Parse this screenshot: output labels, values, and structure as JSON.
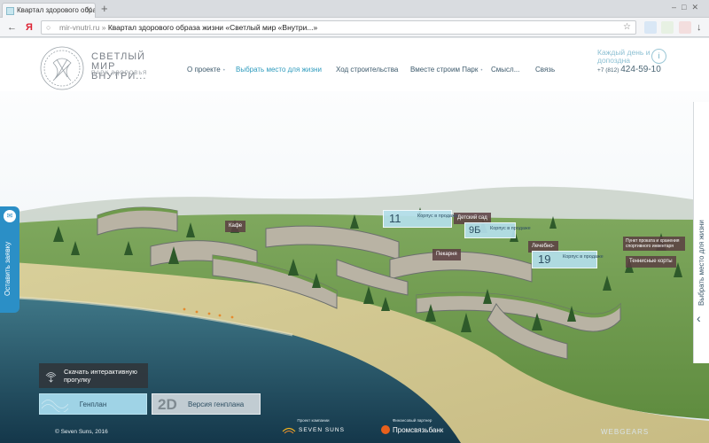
{
  "browser": {
    "tab_title": "Квартал здорового образа",
    "address_domain": "mir-vnutri.ru",
    "address_sep": " » ",
    "page_title": "Квартал здорового образа жизни «Светлый мир «Внутри...»"
  },
  "header": {
    "logo_title": "СВЕТЛЫЙ МИР ВНУТРИ...",
    "logo_subtitle": "ПАРК ЗДОРОВЬЯ",
    "nav": [
      {
        "label": "О проекте",
        "active": false,
        "dropdown": true
      },
      {
        "label": "Выбрать место для жизни",
        "active": true,
        "dropdown": false
      },
      {
        "label": "Ход строительства",
        "active": false,
        "dropdown": false
      },
      {
        "label": "Вместе строим Парк",
        "active": false,
        "dropdown": true
      },
      {
        "label": "Смысл...",
        "active": false,
        "dropdown": false
      },
      {
        "label": "Связь",
        "active": false,
        "dropdown": false
      }
    ],
    "slogan": "Каждый день и допоздна",
    "phone_prefix": "+7 (812)",
    "phone_number": "424-59-10"
  },
  "side": {
    "feedback": "Оставить заявку",
    "choose_place": "Выбрать место для жизни"
  },
  "map_labels": [
    {
      "text": "Кафе"
    },
    {
      "text": "Детский сад"
    },
    {
      "text": "Пекарня"
    },
    {
      "text": "Лечебно-"
    },
    {
      "text": "Пункт проката и хранения спортивного инвентаря"
    },
    {
      "text": "Теннисные корты"
    }
  ],
  "korpuses": [
    {
      "num": "11",
      "text": "Корпус в продаже"
    },
    {
      "num": "9Б",
      "text": "Корпус в продаже"
    },
    {
      "num": "19",
      "text": "Корпус в продаже"
    }
  ],
  "controls": {
    "tour": "Скачать интерактивную прогулку",
    "genplan": "Генплан",
    "d2_mark": "2D",
    "version": "Версия генплана"
  },
  "footer": {
    "copyright": "© Seven Suns, 2016",
    "partner1_caption": "Проект компании",
    "partner1_name": "SEVEN SUNS",
    "partner2_caption": "Финансовый партнер",
    "partner2_name": "Промсвязьбанк",
    "developer": "WEBGEARS"
  },
  "colors": {
    "accent": "#2e9bbd",
    "feedback_tab": "#2b8fc6",
    "label_bg": "#5a3e42",
    "korpus_bg": "#b4dfeb"
  }
}
